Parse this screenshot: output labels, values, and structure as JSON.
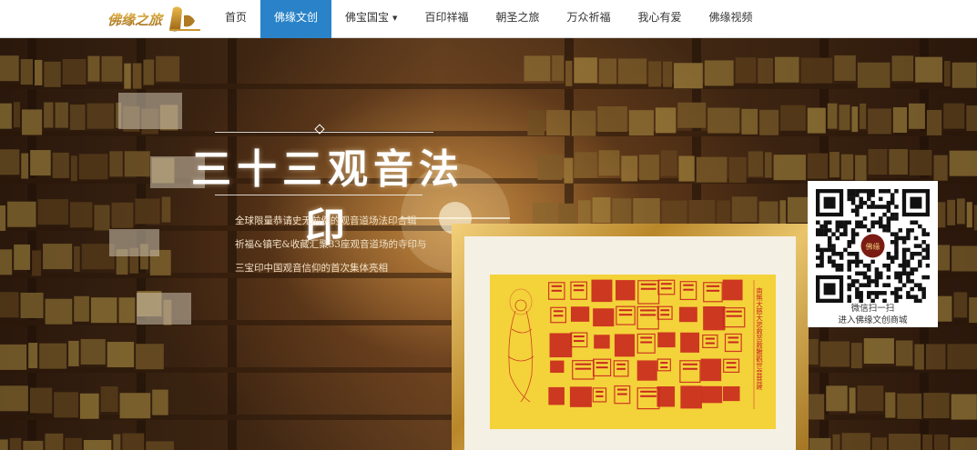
{
  "brand": {
    "logo_text": "佛缘之旅"
  },
  "nav": {
    "items": [
      {
        "label": "首页",
        "active": false
      },
      {
        "label": "佛缘文创",
        "active": true
      },
      {
        "label": "佛宝国宝",
        "active": false,
        "dropdown": true
      },
      {
        "label": "百印祥福",
        "active": false
      },
      {
        "label": "朝圣之旅",
        "active": false
      },
      {
        "label": "万众祈福",
        "active": false
      },
      {
        "label": "我心有爱",
        "active": false
      },
      {
        "label": "佛缘视频",
        "active": false
      }
    ],
    "active_color": "#2a83c8"
  },
  "hero": {
    "title": "三十三观音法印",
    "description": [
      "全球限量恭请史无前例的观音道场法印合辑",
      "祈福&镇宅&收藏汇聚33座观音道场的寺印与",
      "三宝印中国观音信仰的首次集体亮相"
    ],
    "artwork_vertical_text": "南無大慈大悲救苦救難觀世音菩薩"
  },
  "qr": {
    "badge_text": "佛缘",
    "caption_line1": "微信扫一扫",
    "caption_line2": "进入佛缘文创商城"
  },
  "colors": {
    "seal_red": "#c8281e",
    "artwork_gold": "#f4d23a",
    "frame_gold": "#d4a443"
  }
}
